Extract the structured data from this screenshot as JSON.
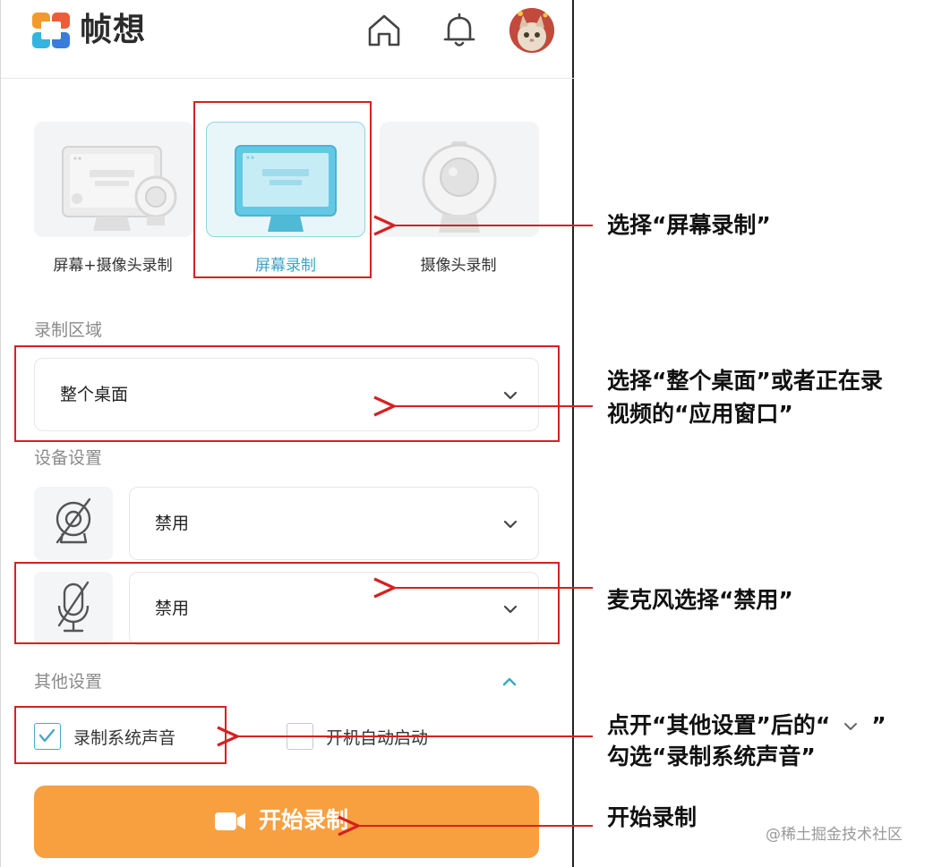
{
  "header": {
    "brand": "帧想",
    "icons": [
      "home-icon",
      "bell-icon",
      "avatar"
    ]
  },
  "modes": [
    {
      "label": "屏幕+摄像头录制",
      "icon": "monitor-camera-icon",
      "active": false
    },
    {
      "label": "屏幕录制",
      "icon": "monitor-icon",
      "active": true
    },
    {
      "label": "摄像头录制",
      "icon": "webcam-icon",
      "active": false
    }
  ],
  "record_area": {
    "title": "录制区域",
    "value": "整个桌面"
  },
  "device_settings": {
    "title": "设备设置",
    "camera": {
      "icon": "camera-disabled-icon",
      "value": "禁用"
    },
    "microphone": {
      "icon": "mic-disabled-icon",
      "value": "禁用"
    }
  },
  "other_settings": {
    "title": "其他设置",
    "record_system_audio": {
      "label": "录制系统声音",
      "checked": true
    },
    "auto_start": {
      "label": "开机自动启动",
      "checked": false
    }
  },
  "start_button": {
    "label": "开始录制",
    "icon": "video-camera-icon"
  },
  "annotations": {
    "select_screen": "选择“屏幕录制”",
    "select_area_line1": "选择“整个桌面”或者正在录",
    "select_area_line2": "视频的“应用窗口”",
    "mic_disable": "麦克风选择“禁用”",
    "other_line1_a": "点开“其他设置”后的“",
    "other_line1_b": "”",
    "other_line2": "勾选“录制系统声音”",
    "start": "开始录制"
  },
  "watermark": "@稀土掘金技术社区",
  "colors": {
    "accent": "#3aa7c4",
    "start_button": "#f8a040",
    "annotation_red": "#d82020"
  }
}
